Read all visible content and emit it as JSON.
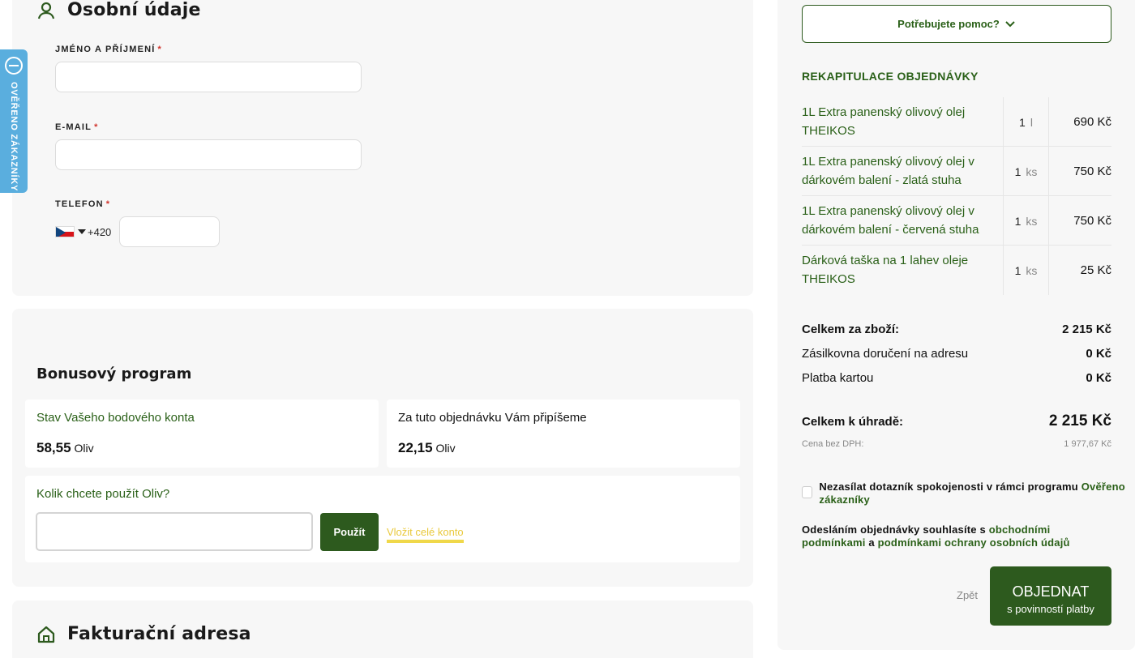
{
  "personal": {
    "title": "Osobní údaje",
    "name_label": "JMÉNO A PŘÍJMENÍ",
    "email_label": "E-MAIL",
    "phone_label": "TELEFON",
    "required_mark": "*",
    "phone_prefix": "+420",
    "name_value": "",
    "email_value": "",
    "phone_value": ""
  },
  "bonus": {
    "title": "Bonusový program",
    "balance_label": "Stav Vašeho bodového konta",
    "balance_value": "58,55",
    "balance_unit": "Oliv",
    "earn_label": "Za tuto objednávku Vám připíšeme",
    "earn_value": "22,15",
    "earn_unit": "Oliv",
    "use_question": "Kolik chcete použít Oliv?",
    "use_value": "",
    "use_button": "Použít",
    "use_all_link": "Vložit celé konto"
  },
  "billing": {
    "title": "Fakturační adresa"
  },
  "verified_tab": {
    "text": "OVĚŘENO ZÁKAZNÍKY"
  },
  "summary": {
    "help_button": "Potřebujete pomoc?",
    "title": "REKAPITULACE OBJEDNÁVKY",
    "items": [
      {
        "name": "1L Extra panenský olivový olej THEIKOS",
        "qty": "1",
        "unit": "l",
        "price": "690 Kč"
      },
      {
        "name": "1L Extra panenský olivový olej v dárkovém balení - zlatá stuha",
        "qty": "1",
        "unit": "ks",
        "price": "750 Kč"
      },
      {
        "name": "1L Extra panenský olivový olej v dárkovém balení - červená stuha",
        "qty": "1",
        "unit": "ks",
        "price": "750 Kč"
      },
      {
        "name": "Dárková taška na 1 lahev oleje THEIKOS",
        "qty": "1",
        "unit": "ks",
        "price": "25 Kč"
      }
    ],
    "goods_total_label": "Celkem za zboží:",
    "goods_total_value": "2 215 Kč",
    "shipping_label": "Zásilkovna doručení na adresu",
    "shipping_value": "0 Kč",
    "payment_label": "Platba kartou",
    "payment_value": "0 Kč",
    "total_label": "Celkem k úhradě:",
    "total_value": "2 215 Kč",
    "net_label": "Cena bez DPH:",
    "net_value": "1 977,67 Kč",
    "survey_text": "Nezasílat dotazník spokojenosti v rámci programu",
    "survey_link": "Ověřeno zákazníky",
    "terms_prefix": "Odesláním objednávky souhlasíte s",
    "terms_link1": "obchodními podmínkami",
    "terms_and": "a",
    "terms_link2": "podmínkami ochrany osobních údajů",
    "back_link": "Zpět",
    "order_button_main": "OBJEDNAT",
    "order_button_sub": "s povinností platby"
  },
  "colors": {
    "brand_green": "#2d5a1e",
    "link_green": "#2a6018",
    "accent_yellow": "#f0d84a",
    "verified_blue": "#5aaede"
  }
}
